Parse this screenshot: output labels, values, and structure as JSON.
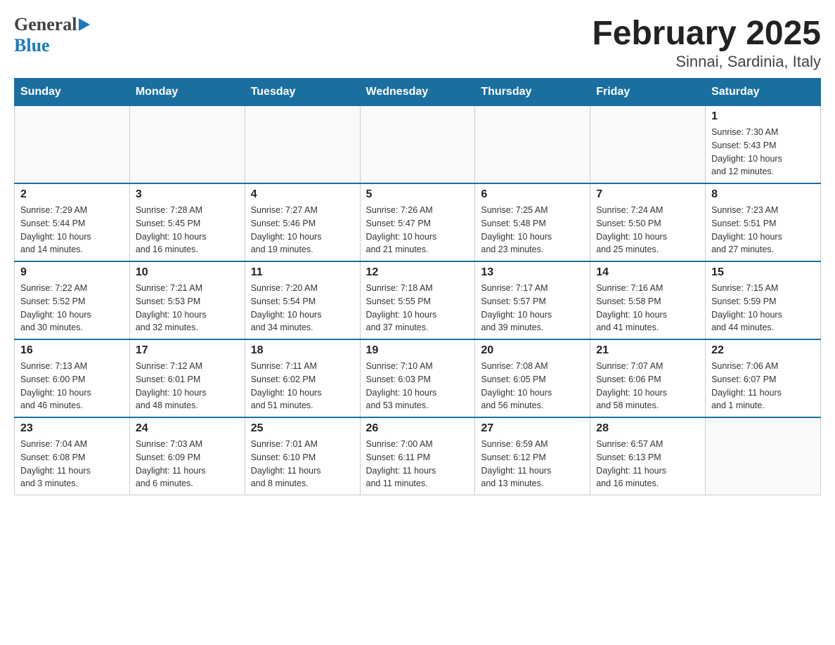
{
  "header": {
    "logo_general": "General",
    "logo_blue": "Blue",
    "month_title": "February 2025",
    "location": "Sinnai, Sardinia, Italy"
  },
  "days_of_week": [
    "Sunday",
    "Monday",
    "Tuesday",
    "Wednesday",
    "Thursday",
    "Friday",
    "Saturday"
  ],
  "weeks": [
    {
      "days": [
        {
          "number": "",
          "info": ""
        },
        {
          "number": "",
          "info": ""
        },
        {
          "number": "",
          "info": ""
        },
        {
          "number": "",
          "info": ""
        },
        {
          "number": "",
          "info": ""
        },
        {
          "number": "",
          "info": ""
        },
        {
          "number": "1",
          "info": "Sunrise: 7:30 AM\nSunset: 5:43 PM\nDaylight: 10 hours\nand 12 minutes."
        }
      ]
    },
    {
      "days": [
        {
          "number": "2",
          "info": "Sunrise: 7:29 AM\nSunset: 5:44 PM\nDaylight: 10 hours\nand 14 minutes."
        },
        {
          "number": "3",
          "info": "Sunrise: 7:28 AM\nSunset: 5:45 PM\nDaylight: 10 hours\nand 16 minutes."
        },
        {
          "number": "4",
          "info": "Sunrise: 7:27 AM\nSunset: 5:46 PM\nDaylight: 10 hours\nand 19 minutes."
        },
        {
          "number": "5",
          "info": "Sunrise: 7:26 AM\nSunset: 5:47 PM\nDaylight: 10 hours\nand 21 minutes."
        },
        {
          "number": "6",
          "info": "Sunrise: 7:25 AM\nSunset: 5:48 PM\nDaylight: 10 hours\nand 23 minutes."
        },
        {
          "number": "7",
          "info": "Sunrise: 7:24 AM\nSunset: 5:50 PM\nDaylight: 10 hours\nand 25 minutes."
        },
        {
          "number": "8",
          "info": "Sunrise: 7:23 AM\nSunset: 5:51 PM\nDaylight: 10 hours\nand 27 minutes."
        }
      ]
    },
    {
      "days": [
        {
          "number": "9",
          "info": "Sunrise: 7:22 AM\nSunset: 5:52 PM\nDaylight: 10 hours\nand 30 minutes."
        },
        {
          "number": "10",
          "info": "Sunrise: 7:21 AM\nSunset: 5:53 PM\nDaylight: 10 hours\nand 32 minutes."
        },
        {
          "number": "11",
          "info": "Sunrise: 7:20 AM\nSunset: 5:54 PM\nDaylight: 10 hours\nand 34 minutes."
        },
        {
          "number": "12",
          "info": "Sunrise: 7:18 AM\nSunset: 5:55 PM\nDaylight: 10 hours\nand 37 minutes."
        },
        {
          "number": "13",
          "info": "Sunrise: 7:17 AM\nSunset: 5:57 PM\nDaylight: 10 hours\nand 39 minutes."
        },
        {
          "number": "14",
          "info": "Sunrise: 7:16 AM\nSunset: 5:58 PM\nDaylight: 10 hours\nand 41 minutes."
        },
        {
          "number": "15",
          "info": "Sunrise: 7:15 AM\nSunset: 5:59 PM\nDaylight: 10 hours\nand 44 minutes."
        }
      ]
    },
    {
      "days": [
        {
          "number": "16",
          "info": "Sunrise: 7:13 AM\nSunset: 6:00 PM\nDaylight: 10 hours\nand 46 minutes."
        },
        {
          "number": "17",
          "info": "Sunrise: 7:12 AM\nSunset: 6:01 PM\nDaylight: 10 hours\nand 48 minutes."
        },
        {
          "number": "18",
          "info": "Sunrise: 7:11 AM\nSunset: 6:02 PM\nDaylight: 10 hours\nand 51 minutes."
        },
        {
          "number": "19",
          "info": "Sunrise: 7:10 AM\nSunset: 6:03 PM\nDaylight: 10 hours\nand 53 minutes."
        },
        {
          "number": "20",
          "info": "Sunrise: 7:08 AM\nSunset: 6:05 PM\nDaylight: 10 hours\nand 56 minutes."
        },
        {
          "number": "21",
          "info": "Sunrise: 7:07 AM\nSunset: 6:06 PM\nDaylight: 10 hours\nand 58 minutes."
        },
        {
          "number": "22",
          "info": "Sunrise: 7:06 AM\nSunset: 6:07 PM\nDaylight: 11 hours\nand 1 minute."
        }
      ]
    },
    {
      "days": [
        {
          "number": "23",
          "info": "Sunrise: 7:04 AM\nSunset: 6:08 PM\nDaylight: 11 hours\nand 3 minutes."
        },
        {
          "number": "24",
          "info": "Sunrise: 7:03 AM\nSunset: 6:09 PM\nDaylight: 11 hours\nand 6 minutes."
        },
        {
          "number": "25",
          "info": "Sunrise: 7:01 AM\nSunset: 6:10 PM\nDaylight: 11 hours\nand 8 minutes."
        },
        {
          "number": "26",
          "info": "Sunrise: 7:00 AM\nSunset: 6:11 PM\nDaylight: 11 hours\nand 11 minutes."
        },
        {
          "number": "27",
          "info": "Sunrise: 6:59 AM\nSunset: 6:12 PM\nDaylight: 11 hours\nand 13 minutes."
        },
        {
          "number": "28",
          "info": "Sunrise: 6:57 AM\nSunset: 6:13 PM\nDaylight: 11 hours\nand 16 minutes."
        },
        {
          "number": "",
          "info": ""
        }
      ]
    }
  ]
}
